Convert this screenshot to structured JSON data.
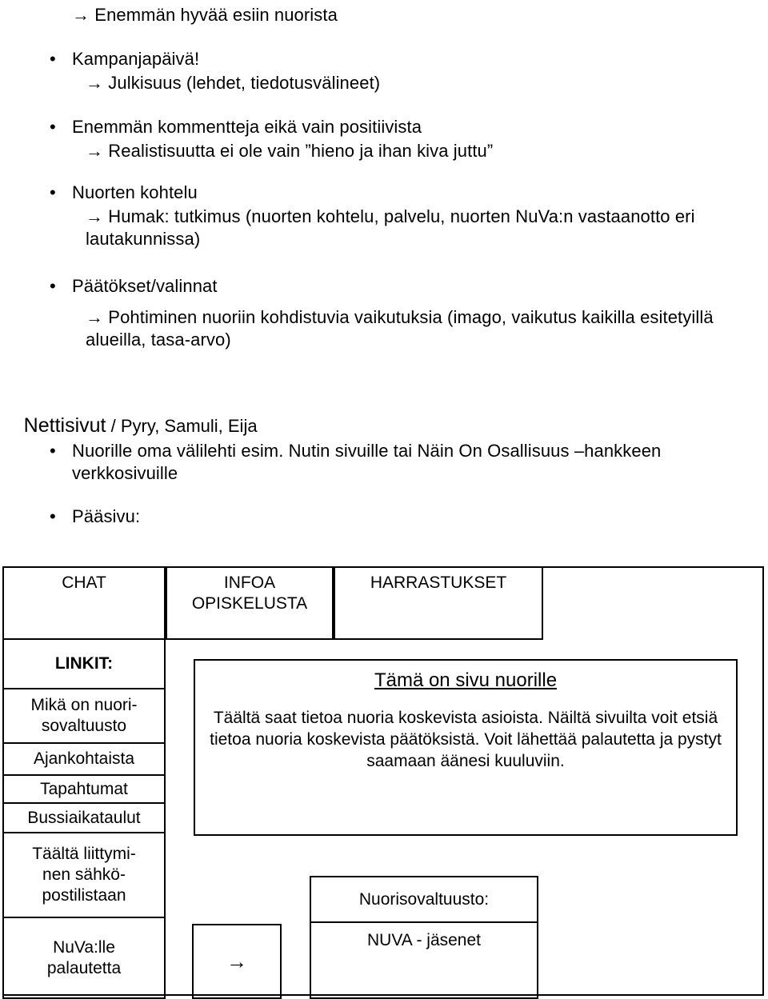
{
  "slide": {
    "lines": [
      {
        "id": "l1",
        "text": "→ Enemmän hyvää esiin nuorista"
      },
      {
        "id": "l2",
        "text": "Kampanjapäivä!"
      },
      {
        "id": "l3",
        "text": "→ Julkisuus (lehdet, tiedotusvälineet)"
      },
      {
        "id": "l4",
        "text": "Enemmän kommentteja eikä vain positiivista"
      },
      {
        "id": "l5",
        "text": "→ Realistisuutta ei ole vain ”hieno ja ihan kiva juttu”"
      },
      {
        "id": "l6",
        "text": "Nuorten kohtelu"
      },
      {
        "id": "l7",
        "text": "→ Humak: tutkimus (nuorten kohtelu, palvelu, nuorten NuVa:n vastaanotto eri lautakunnissa)"
      },
      {
        "id": "l8",
        "text": "Päätökset/valinnat"
      },
      {
        "id": "l9",
        "text": "→ Pohtiminen nuoriin kohdistuvia vaikutuksia (imago, vaikutus kaikilla esitetyillä alueilla, tasa-arvo)"
      },
      {
        "id": "l10",
        "text": "Nuorille oma välilehti esim. Nutin sivuille tai Näin On Osallisuus –hankkeen verkkosivuille"
      },
      {
        "id": "l11",
        "text": "Pääsivu:"
      }
    ],
    "bullet_glyph": "•",
    "section_heading": {
      "primary": "Nettisivut",
      "secondary": " / Pyry, Samuli, Eija"
    }
  },
  "mockup": {
    "nav_tabs": [
      {
        "label": "CHAT"
      },
      {
        "label": "INFOA\nOPISKELUSTA"
      },
      {
        "label": "HARRASTUKSET"
      }
    ],
    "links_header": "LINKIT:",
    "links": [
      {
        "label": "Mikä on nuori-\nsovaltuusto"
      },
      {
        "label": "Ajankohtaista"
      },
      {
        "label": "Tapahtumat"
      },
      {
        "label": "Bussiaikataulut"
      },
      {
        "label": "Täältä liittymi-\nnen sähkö-\npostilistaan"
      },
      {
        "label": "NuVa:lle\npalautetta"
      }
    ],
    "content": {
      "title": "Tämä on sivu nuorille",
      "body": "Täältä saat tietoa nuoria koskevista asioista. Näiltä sivuilta voit etsiä tietoa nuoria koskevista päätöksistä. Voit lähettää palautetta ja pystyt saamaan äänesi kuuluviin."
    },
    "arrow": "→",
    "nuva": {
      "header": "Nuorisovaltuusto:",
      "body": "NUVA - jäsenet"
    }
  },
  "colors": {
    "text": "#000000",
    "background": "#ffffff",
    "border": "#000000"
  }
}
